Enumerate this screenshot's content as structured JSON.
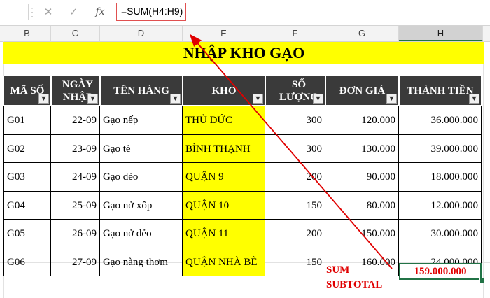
{
  "formula_bar": {
    "cancel_icon": "close-icon",
    "enter_icon": "check-icon",
    "fx_label": "fx",
    "formula": "=SUM(H4:H9)"
  },
  "column_headers": [
    "B",
    "C",
    "D",
    "E",
    "F",
    "G",
    "H"
  ],
  "selected_column": "H",
  "sheet": {
    "title": "NHẬP KHO GẠO",
    "headers": [
      "MÃ SỐ",
      "NGÀY NHẬP",
      "TÊN HÀNG",
      "KHO",
      "SỐ LƯỢNG",
      "ĐƠN GIÁ",
      "THÀNH TIỀN"
    ],
    "rows": [
      [
        "G01",
        "22-09",
        "Gạo nếp",
        "THỦ ĐỨC",
        "300",
        "120.000",
        "36.000.000"
      ],
      [
        "G02",
        "23-09",
        "Gạo tẻ",
        "BÌNH THẠNH",
        "300",
        "130.000",
        "39.000.000"
      ],
      [
        "G03",
        "24-09",
        "Gạo dẻo",
        "QUẬN 9",
        "200",
        "90.000",
        "18.000.000"
      ],
      [
        "G04",
        "25-09",
        "Gạo nở xốp",
        "QUẬN 10",
        "150",
        "80.000",
        "12.000.000"
      ],
      [
        "G05",
        "26-09",
        "Gạo nở dẻo",
        "QUẬN 11",
        "200",
        "150.000",
        "30.000.000"
      ],
      [
        "G06",
        "27-09",
        "Gạo nàng thơm",
        "QUẬN NHÀ BÈ",
        "150",
        "160.000",
        "24.000.000"
      ]
    ],
    "sum_label_1": "SUM",
    "sum_label_2": "SUBTOTAL",
    "sum_value": "159.000.000"
  },
  "colors": {
    "title_fill": "#ffff00",
    "header_fill": "#3a3a3a",
    "kho_fill": "#ffff00",
    "accent_red": "#e00000",
    "selection_green": "#217346"
  }
}
